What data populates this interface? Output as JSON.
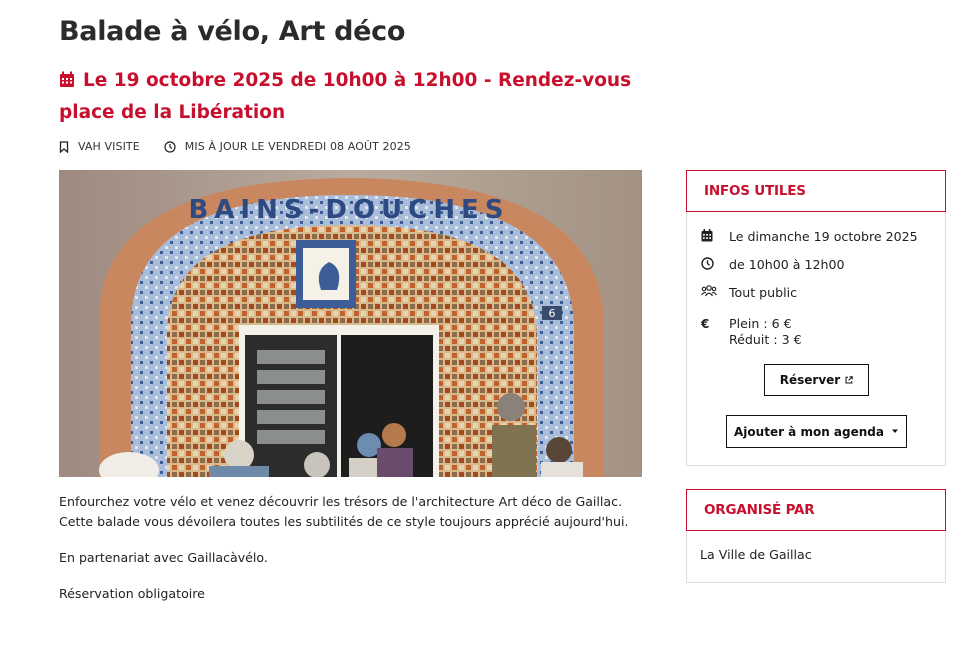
{
  "page": {
    "title": "Balade à vélo, Art déco",
    "event_heading": "Le 19 octobre 2025 de 10h00 à 12h00 - Rendez-vous place de la Libération"
  },
  "meta": {
    "category": "VAH VISITE",
    "updated": "MIS À JOUR LE VENDREDI 08 AOÛT 2025"
  },
  "hero": {
    "inscription": "BAINS-DOUCHES",
    "door_number": "6"
  },
  "description": {
    "paragraphs": [
      "Enfourchez votre vélo et venez découvrir les trésors de l'architecture Art déco de Gaillac. Cette balade vous dévoilera toutes les subtilités de ce style toujours apprécié aujourd'hui.",
      "En partenariat avec Gaillacàvélo.",
      "Réservation obligatoire"
    ]
  },
  "infos": {
    "title": "INFOS UTILES",
    "date": "Le dimanche 19 octobre 2025",
    "time": "de 10h00 à 12h00",
    "audience": "Tout public",
    "price_full": "Plein : 6 €",
    "price_reduced": "Réduit : 3 €",
    "reserve_label": "Réserver",
    "agenda_label": "Ajouter à mon agenda"
  },
  "organizer": {
    "title": "ORGANISÉ PAR",
    "name": "La Ville de Gaillac"
  },
  "colors": {
    "accent": "#c8102e",
    "text": "#222222",
    "border": "#dcdcdc"
  },
  "icons": [
    "calendar-icon",
    "bookmark-icon",
    "clock-icon",
    "people-icon",
    "euro-icon",
    "external-link-icon",
    "caret-down-icon"
  ]
}
